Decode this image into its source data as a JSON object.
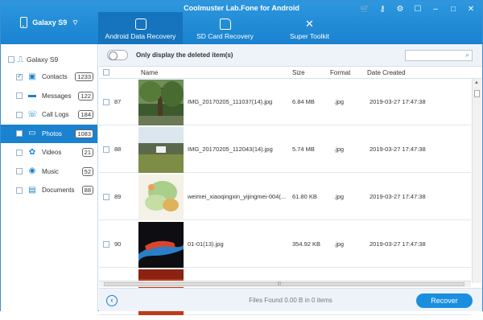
{
  "app": {
    "title": "Coolmuster Lab.Fone for Android",
    "device_name": "Galaxy S9"
  },
  "tabs": [
    {
      "label": "Android Data Recovery",
      "active": true
    },
    {
      "label": "SD Card Recovery",
      "active": false
    },
    {
      "label": "Super Toolkit",
      "active": false
    }
  ],
  "window_controls": [
    "cart-icon",
    "key-icon",
    "settings-icon",
    "feedback-icon",
    "minimize-icon",
    "maximize-icon",
    "close-icon"
  ],
  "sidebar": {
    "root_label": "Galaxy S9",
    "items": [
      {
        "label": "Contacts",
        "count": "1233",
        "icon": "contacts-icon",
        "checked": true
      },
      {
        "label": "Messages",
        "count": "122",
        "icon": "messages-icon",
        "checked": false
      },
      {
        "label": "Call Logs",
        "count": "184",
        "icon": "call-logs-icon",
        "checked": false
      },
      {
        "label": "Photos",
        "count": "1083",
        "icon": "photos-icon",
        "checked": false,
        "active": true
      },
      {
        "label": "Videos",
        "count": "21",
        "icon": "videos-icon",
        "checked": false
      },
      {
        "label": "Music",
        "count": "52",
        "icon": "music-icon",
        "checked": false
      },
      {
        "label": "Documents",
        "count": "88",
        "icon": "documents-icon",
        "checked": false
      }
    ]
  },
  "filter": {
    "label": "Only display the deleted item(s)",
    "search_placeholder": ""
  },
  "table": {
    "columns": [
      "Name",
      "Size",
      "Format",
      "Date Created"
    ],
    "rows": [
      {
        "index": "87",
        "name": "IMG_20170205_111037(14).jpg",
        "size": "6.84 MB",
        "format": ".jpg",
        "date": "2019-03-27  17:47:38"
      },
      {
        "index": "88",
        "name": "IMG_20170205_112043(14).jpg",
        "size": "5.74 MB",
        "format": ".jpg",
        "date": "2019-03-27  17:47:38"
      },
      {
        "index": "89",
        "name": "weimei_xiaoqingxin_yijingmei-004(...",
        "size": "61.80 KB",
        "format": ".jpg",
        "date": "2019-03-27  17:47:38"
      },
      {
        "index": "90",
        "name": "01-01(13).jpg",
        "size": "354.92 KB",
        "format": ".jpg",
        "date": "2019-03-27  17:47:38"
      }
    ]
  },
  "footer": {
    "status": "Files Found 0.00 B in 0 items",
    "recover_label": "Recover"
  },
  "colors": {
    "accent": "#1a82cf",
    "header": "#2d97df",
    "active_tab": "#1574bd"
  }
}
